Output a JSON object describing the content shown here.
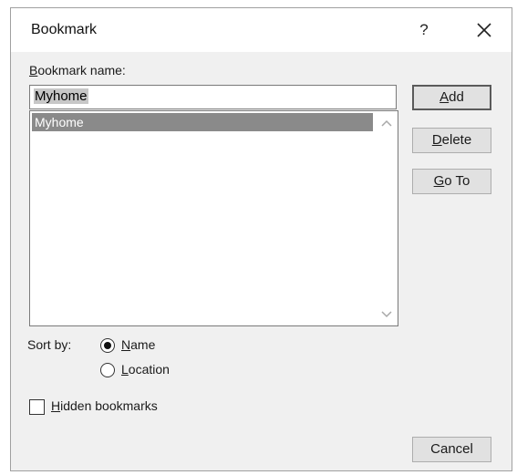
{
  "dialog": {
    "title": "Bookmark",
    "help_label": "?",
    "icons": {
      "close": "close-icon",
      "help": "help-icon",
      "scroll_up": "chevron-up-icon",
      "scroll_down": "chevron-down-icon"
    }
  },
  "bookmark_name": {
    "label_accel": "B",
    "label_rest": "ookmark name:",
    "value": "Myhome"
  },
  "list": {
    "items": [
      "Myhome"
    ],
    "selected_index": 0
  },
  "buttons": {
    "add": {
      "accel": "A",
      "rest": "dd"
    },
    "delete": {
      "accel": "D",
      "rest": "elete"
    },
    "goto": {
      "accel": "G",
      "rest": "o To"
    },
    "cancel": "Cancel"
  },
  "sort": {
    "label": "Sort by:",
    "options": [
      {
        "accel": "N",
        "rest": "ame",
        "selected": true
      },
      {
        "accel": "L",
        "rest": "ocation",
        "selected": false
      }
    ]
  },
  "hidden": {
    "accel": "H",
    "rest": "idden bookmarks",
    "checked": false
  },
  "colors": {
    "dialog_bg": "#f0f0f0",
    "selection_bg": "#8a8a8a",
    "input_selection_bg": "#c7c7c7",
    "button_bg": "#e1e1e1"
  }
}
